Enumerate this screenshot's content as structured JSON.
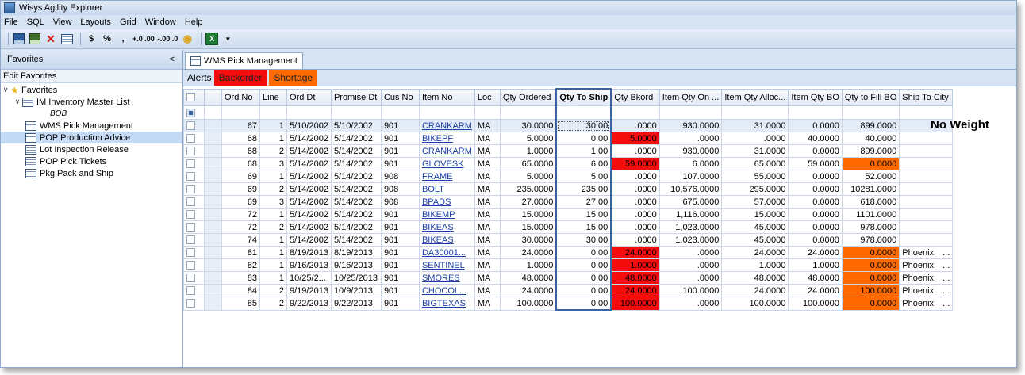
{
  "window": {
    "title": "Wisys Agility Explorer"
  },
  "menu": [
    "File",
    "SQL",
    "View",
    "Layouts",
    "Grid",
    "Window",
    "Help"
  ],
  "toolbar": {
    "dollar": "$",
    "percent": "%",
    "comma": ",",
    "inc_decimal": "+.0 .00",
    "dec_decimal": "-.00 .0"
  },
  "sidebar": {
    "header": "Favorites",
    "collapse": "<",
    "edit_label": "Edit Favorites",
    "root": "Favorites",
    "items": [
      {
        "label": "IM Inventory Master List",
        "child": "BOB"
      },
      {
        "label": "WMS Pick Management"
      },
      {
        "label": "POP Production Advice"
      },
      {
        "label": "Lot Inspection Release"
      },
      {
        "label": "POP Pick Tickets"
      },
      {
        "label": "Pkg Pack and Ship"
      }
    ]
  },
  "tab": {
    "label": "WMS Pick Management"
  },
  "alerts": {
    "label": "Alerts",
    "backorder": "Backorder",
    "shortage": "Shortage",
    "backorder_color": "#f50d0d",
    "shortage_color": "#ff6a00"
  },
  "grid": {
    "columns": [
      "Ord No",
      "Line",
      "Ord Dt",
      "Promise Dt",
      "Cus No",
      "Item No",
      "Loc",
      "Qty Ordered",
      "Qty To Ship",
      "Qty Bkord",
      "Item Qty On ...",
      "Item Qty Alloc...",
      "Item Qty BO",
      "Qty to Fill BO",
      "Ship To City"
    ],
    "rows": [
      [
        "67",
        "1",
        "5/10/2002",
        "5/10/2002",
        "901",
        "CRANKARM",
        "MA",
        "30.0000",
        "30.00",
        ".0000",
        "930.0000",
        "31.0000",
        "0.0000",
        "899.0000",
        ""
      ],
      [
        "68",
        "1",
        "5/14/2002",
        "5/14/2002",
        "901",
        "BIKEPF",
        "MA",
        "5.0000",
        "0.00",
        "5.0000",
        ".0000",
        ".0000",
        "40.0000",
        "40.0000",
        ""
      ],
      [
        "68",
        "2",
        "5/14/2002",
        "5/14/2002",
        "901",
        "CRANKARM",
        "MA",
        "1.0000",
        "1.00",
        ".0000",
        "930.0000",
        "31.0000",
        "0.0000",
        "899.0000",
        ""
      ],
      [
        "68",
        "3",
        "5/14/2002",
        "5/14/2002",
        "901",
        "GLOVESK",
        "MA",
        "65.0000",
        "6.00",
        "59.0000",
        "6.0000",
        "65.0000",
        "59.0000",
        "0.0000",
        ""
      ],
      [
        "69",
        "1",
        "5/14/2002",
        "5/14/2002",
        "908",
        "FRAME",
        "MA",
        "5.0000",
        "5.00",
        ".0000",
        "107.0000",
        "55.0000",
        "0.0000",
        "52.0000",
        ""
      ],
      [
        "69",
        "2",
        "5/14/2002",
        "5/14/2002",
        "908",
        "BOLT",
        "MA",
        "235.0000",
        "235.00",
        ".0000",
        "10,576.0000",
        "295.0000",
        "0.0000",
        "10281.0000",
        ""
      ],
      [
        "69",
        "3",
        "5/14/2002",
        "5/14/2002",
        "908",
        "BPADS",
        "MA",
        "27.0000",
        "27.00",
        ".0000",
        "675.0000",
        "57.0000",
        "0.0000",
        "618.0000",
        ""
      ],
      [
        "72",
        "1",
        "5/14/2002",
        "5/14/2002",
        "901",
        "BIKEMP",
        "MA",
        "15.0000",
        "15.00",
        ".0000",
        "1,116.0000",
        "15.0000",
        "0.0000",
        "1101.0000",
        ""
      ],
      [
        "72",
        "2",
        "5/14/2002",
        "5/14/2002",
        "901",
        "BIKEAS",
        "MA",
        "15.0000",
        "15.00",
        ".0000",
        "1,023.0000",
        "45.0000",
        "0.0000",
        "978.0000",
        ""
      ],
      [
        "74",
        "1",
        "5/14/2002",
        "5/14/2002",
        "901",
        "BIKEAS",
        "MA",
        "30.0000",
        "30.00",
        ".0000",
        "1,023.0000",
        "45.0000",
        "0.0000",
        "978.0000",
        ""
      ],
      [
        "81",
        "1",
        "8/19/2013",
        "8/19/2013",
        "901",
        "DA30001...",
        "MA",
        "24.0000",
        "0.00",
        "24.0000",
        ".0000",
        "24.0000",
        "24.0000",
        "0.0000",
        "Phoenix"
      ],
      [
        "82",
        "1",
        "9/16/2013",
        "9/16/2013",
        "901",
        "SENTINEL",
        "MA",
        "1.0000",
        "0.00",
        "1.0000",
        ".0000",
        "1.0000",
        "1.0000",
        "0.0000",
        "Phoenix"
      ],
      [
        "83",
        "1",
        "10/25/2...",
        "10/25/2013",
        "901",
        "SMORES",
        "MA",
        "48.0000",
        "0.00",
        "48.0000",
        ".0000",
        "48.0000",
        "48.0000",
        "0.0000",
        "Phoenix"
      ],
      [
        "84",
        "2",
        "9/19/2013",
        "10/9/2013",
        "901",
        "CHOCOL...",
        "MA",
        "24.0000",
        "0.00",
        "24.0000",
        "100.0000",
        "24.0000",
        "24.0000",
        "100.0000",
        "Phoenix"
      ],
      [
        "85",
        "2",
        "9/22/2013",
        "9/22/2013",
        "901",
        "BIGTEXAS",
        "MA",
        "100.0000",
        "0.00",
        "100.0000",
        ".0000",
        "100.0000",
        "100.0000",
        "0.0000",
        "Phoenix"
      ]
    ],
    "ellipsis": "...",
    "bkord_flag": [
      false,
      true,
      false,
      true,
      false,
      false,
      false,
      false,
      false,
      false,
      true,
      true,
      true,
      true,
      true
    ],
    "fill_flag": [
      false,
      false,
      false,
      true,
      false,
      false,
      false,
      false,
      false,
      false,
      true,
      true,
      true,
      true,
      true
    ]
  },
  "annotation": "No Weight"
}
